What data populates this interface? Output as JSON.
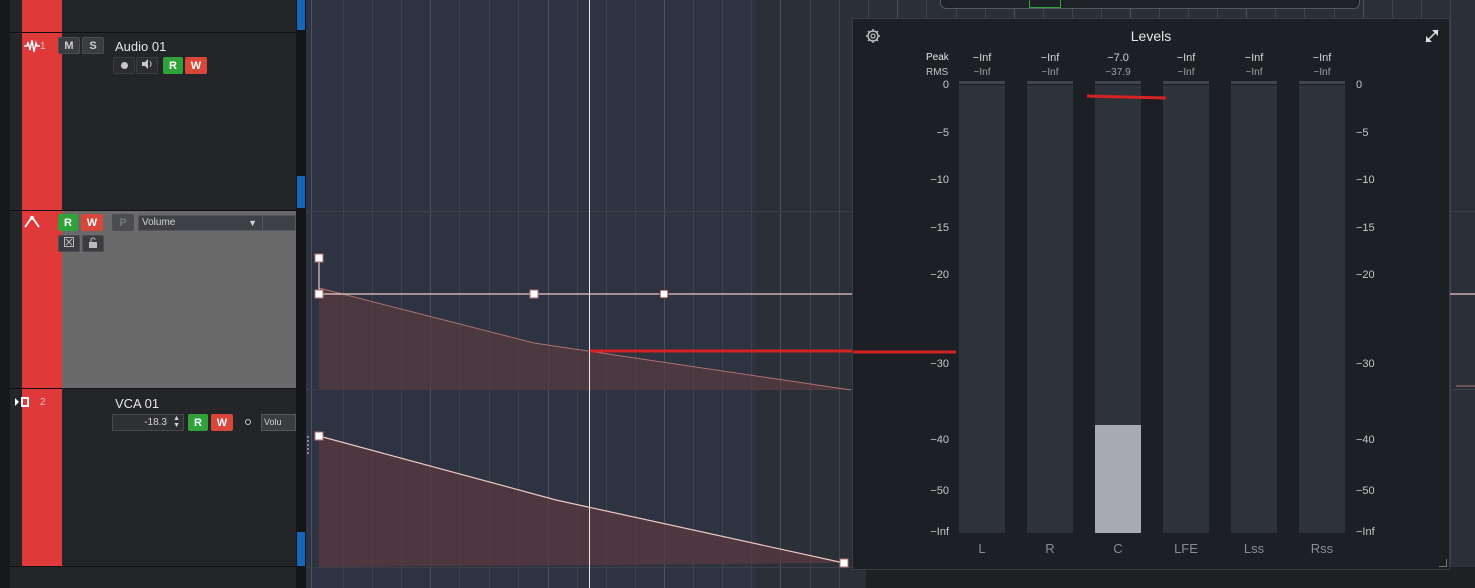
{
  "tracks": [
    {
      "number": "1",
      "name": "Audio 01",
      "mute": "M",
      "solo": "S",
      "read": "R",
      "write": "W"
    },
    {
      "automation_param": "Volume",
      "read": "R",
      "write": "W",
      "p_btn": "P"
    },
    {
      "number": "2",
      "name": "VCA 01",
      "read": "R",
      "write": "W",
      "value": "-18.3",
      "param_short": "Volu"
    }
  ],
  "levels": {
    "title": "Levels",
    "peak_label": "Peak",
    "rms_label": "RMS",
    "channels": [
      {
        "name": "L",
        "peak": "−Inf",
        "rms": "−Inf",
        "level_fraction": 0
      },
      {
        "name": "R",
        "peak": "−Inf",
        "rms": "−Inf",
        "level_fraction": 0
      },
      {
        "name": "C",
        "peak": "−7.0",
        "rms": "−37.9",
        "level_fraction": 0.24
      },
      {
        "name": "LFE",
        "peak": "−Inf",
        "rms": "−Inf",
        "level_fraction": 0
      },
      {
        "name": "Lss",
        "peak": "−Inf",
        "rms": "−Inf",
        "level_fraction": 0
      },
      {
        "name": "Rss",
        "peak": "−Inf",
        "rms": "−Inf",
        "level_fraction": 0
      }
    ],
    "scale": [
      "0",
      "−5",
      "−10",
      "−15",
      "−20",
      "−30",
      "−40",
      "−50",
      "−Inf"
    ]
  },
  "colors": {
    "track_red": "#e0393a",
    "read_green": "#2fa33a",
    "write_red": "#d9473b",
    "automation_line": "#f0c8c4"
  },
  "icons": [
    "waveform-icon",
    "automation-icon",
    "vca-icon",
    "record-icon",
    "monitor-icon",
    "settings-gear-icon",
    "resize-icon",
    "lock-icon",
    "close-box-icon"
  ]
}
